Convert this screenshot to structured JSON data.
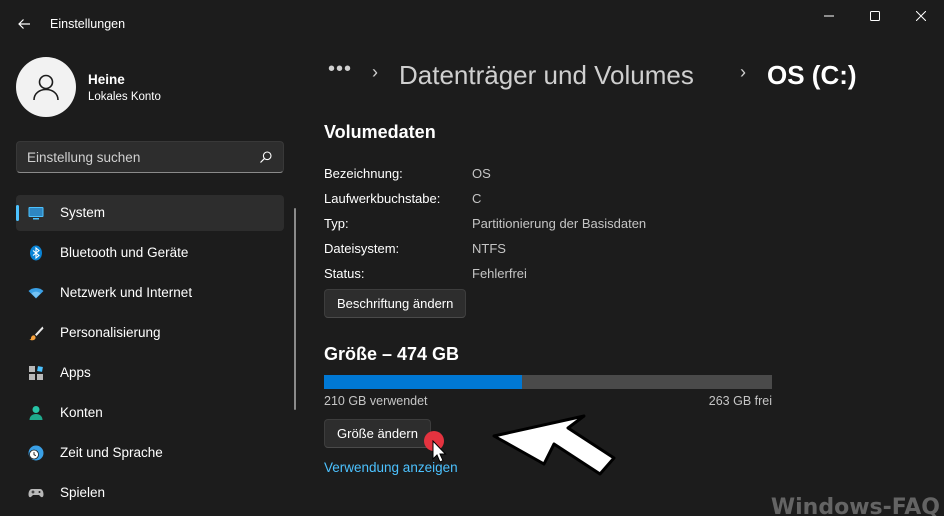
{
  "window": {
    "title": "Einstellungen"
  },
  "user": {
    "name": "Heine",
    "account": "Lokales Konto"
  },
  "search": {
    "placeholder": "Einstellung suchen"
  },
  "nav": [
    {
      "label": "System",
      "icon": "system-icon",
      "active": true
    },
    {
      "label": "Bluetooth und Geräte",
      "icon": "bluetooth-icon"
    },
    {
      "label": "Netzwerk und Internet",
      "icon": "wifi-icon"
    },
    {
      "label": "Personalisierung",
      "icon": "brush-icon"
    },
    {
      "label": "Apps",
      "icon": "apps-icon"
    },
    {
      "label": "Konten",
      "icon": "person-icon"
    },
    {
      "label": "Zeit und Sprache",
      "icon": "clock-globe-icon"
    },
    {
      "label": "Spielen",
      "icon": "gamepad-icon"
    }
  ],
  "breadcrumb": {
    "more": "•••",
    "parent": "Datenträger und Volumes",
    "current": "OS (C:)"
  },
  "volume": {
    "title": "Volumedaten",
    "rows": [
      {
        "label": "Bezeichnung:",
        "value": "OS"
      },
      {
        "label": "Laufwerkbuchstabe:",
        "value": "C"
      },
      {
        "label": "Typ:",
        "value": "Partitionierung der Basisdaten"
      },
      {
        "label": "Dateisystem:",
        "value": "NTFS"
      },
      {
        "label": "Status:",
        "value": "Fehlerfrei"
      }
    ],
    "rename_button": "Beschriftung ändern"
  },
  "size": {
    "title": "Größe – 474 GB",
    "used_fraction": 0.443,
    "used_label": "210 GB verwendet",
    "free_label": "263 GB frei",
    "resize_button": "Größe ändern",
    "usage_link": "Verwendung anzeigen"
  },
  "watermark": "Windows-FAQ",
  "colors": {
    "accent": "#4cc2ff",
    "bar_fill": "#0078d4",
    "background": "#1c1c1c"
  }
}
